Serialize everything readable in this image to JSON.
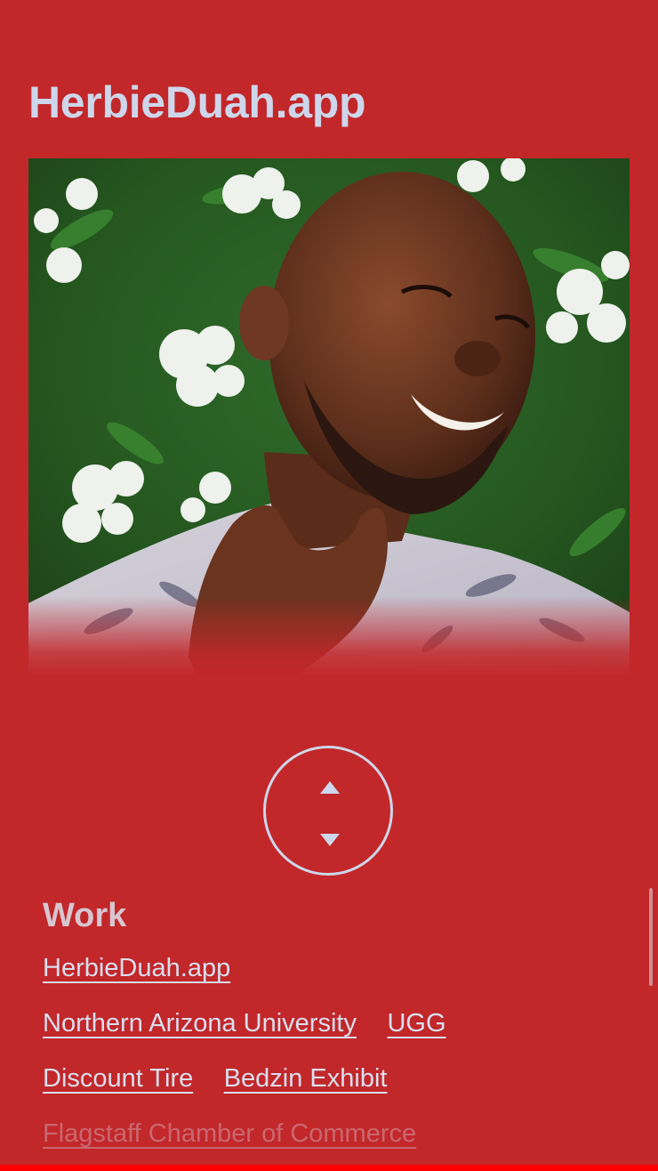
{
  "header": {
    "title": "HerbieDuah.app"
  },
  "hero": {
    "alt": "Portrait photo of a smiling man in front of white flowers"
  },
  "scroll_toggle": {
    "up_icon": "triangle-up-icon",
    "down_icon": "triangle-down-icon"
  },
  "work": {
    "heading": "Work",
    "rows": [
      [
        "HerbieDuah.app"
      ],
      [
        "Northern Arizona University",
        "UGG"
      ],
      [
        "Discount Tire",
        "Bedzin Exhibit"
      ],
      [
        "Flagstaff Chamber of Commerce"
      ]
    ]
  },
  "colors": {
    "background": "#c2272a",
    "text": "#cdd6ea",
    "bottom_bar": "#ff0000"
  }
}
